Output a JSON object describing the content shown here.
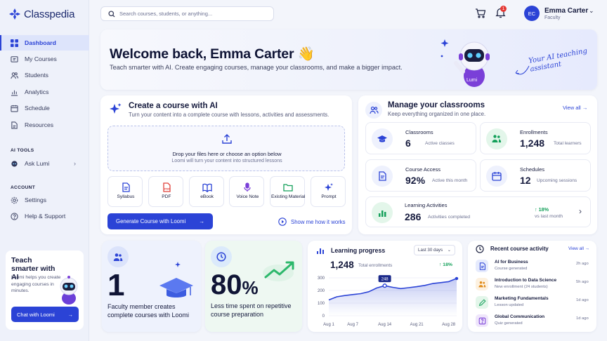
{
  "app": {
    "name": "Classpedia"
  },
  "search": {
    "placeholder": "Search courses, students, or anything..."
  },
  "header": {
    "notification_count": "1",
    "user_initials": "EC",
    "user_name": "Emma Carter",
    "user_role": "Faculty"
  },
  "sidebar": {
    "items": [
      {
        "label": "Dashboard",
        "icon": "grid-icon"
      },
      {
        "label": "My Courses",
        "icon": "courses-icon"
      },
      {
        "label": "Students",
        "icon": "students-icon"
      },
      {
        "label": "Analytics",
        "icon": "bar-chart-icon"
      },
      {
        "label": "Schedule",
        "icon": "calendar-icon"
      },
      {
        "label": "Resources",
        "icon": "document-icon"
      }
    ],
    "ai_tools_heading": "AI TOOLS",
    "ask_lumi": "Ask Lumi",
    "account_heading": "ACCOUNT",
    "settings": "Settings",
    "help": "Help & Support"
  },
  "promo": {
    "title": "Teach smarter with AI",
    "text": "Loomi helps you create engaging courses in minutes.",
    "button": "Chat with Loomi"
  },
  "hero": {
    "title": "Welcome back, Emma Carter",
    "emoji": "👋",
    "subtitle": "Teach smarter with AI. Create engaging courses, manage your classrooms, and make a bigger impact.",
    "assistant_note": "Your AI teaching assistant",
    "robot_badge": "Lumi"
  },
  "create": {
    "title": "Create a course with AI",
    "subtitle": "Turn your content into a complete course with lessons, activities and assessments.",
    "drop_title": "Drop your files here or choose an option below",
    "drop_sub": "Loomi will turn your content into structured lessons",
    "options": [
      {
        "label": "Syllabus",
        "icon": "syllabus-icon",
        "color": "#2b43d6"
      },
      {
        "label": "PDF",
        "icon": "pdf-icon",
        "color": "#e0413b"
      },
      {
        "label": "eBook",
        "icon": "ebook-icon",
        "color": "#2b43d6"
      },
      {
        "label": "Voice Note",
        "icon": "microphone-icon",
        "color": "#7a3fd8"
      },
      {
        "label": "Existing Material",
        "icon": "folder-icon",
        "color": "#14a05a"
      },
      {
        "label": "Prompt",
        "icon": "sparkle-icon",
        "color": "#2b43d6"
      }
    ],
    "generate_button": "Generate Course with Loomi",
    "show_link": "Show me how it works"
  },
  "classrooms": {
    "title": "Manage your classrooms",
    "subtitle": "Keep everything organized in one place.",
    "view_all": "View all",
    "stats": [
      {
        "label": "Classrooms",
        "value": "6",
        "caption": "Active classes",
        "icon": "graduation-cap-icon"
      },
      {
        "label": "Enrollments",
        "value": "1,248",
        "caption": "Total learners",
        "icon": "users-icon"
      },
      {
        "label": "Course Access",
        "value": "92%",
        "caption": "Active this month",
        "icon": "document-icon"
      },
      {
        "label": "Schedules",
        "value": "12",
        "caption": "Upcoming sessions",
        "icon": "calendar-icon"
      }
    ],
    "activities": {
      "label": "Learning Activities",
      "value": "286",
      "caption": "Activities completed",
      "change": "18%",
      "change_caption": "vs last month"
    }
  },
  "faculty": {
    "value": "1",
    "text": "Faculty member creates complete courses with Loomi"
  },
  "time": {
    "value": "80",
    "unit": "%",
    "text": "Less time spent on repetitive course preparation"
  },
  "progress": {
    "title": "Learning progress",
    "range": "Last 30 days",
    "value": "1,248",
    "value_caption": "Total enrollments",
    "change": "18%"
  },
  "chart_data": {
    "type": "line",
    "x": [
      "Aug 1",
      "Aug 3",
      "Aug 5",
      "Aug 7",
      "Aug 9",
      "Aug 11",
      "Aug 13",
      "Aug 14",
      "Aug 16",
      "Aug 18",
      "Aug 20",
      "Aug 21",
      "Aug 23",
      "Aug 25",
      "Aug 27",
      "Aug 28",
      "Aug 30"
    ],
    "values": [
      125,
      150,
      160,
      168,
      175,
      190,
      220,
      238,
      225,
      215,
      222,
      230,
      240,
      255,
      262,
      270,
      295
    ],
    "xticks": [
      "Aug 1",
      "Aug 7",
      "Aug 14",
      "Aug 21",
      "Aug 28"
    ],
    "yticks": [
      "300",
      "200",
      "100",
      "0"
    ],
    "ylim": [
      0,
      300
    ],
    "highlight": {
      "x": "Aug 14",
      "label": "248"
    },
    "grid": true,
    "color": "#2b43d6"
  },
  "activity": {
    "title": "Recent course activity",
    "view_all": "View all",
    "items": [
      {
        "title": "AI for Business",
        "sub": "Course generated",
        "time": "2h ago",
        "icon": "document-icon",
        "color": "#2b43d6",
        "bg": "#e6ebfd"
      },
      {
        "title": "Introduction to Data Science",
        "sub": "New enrollment (24 students)",
        "time": "5h ago",
        "icon": "users-icon",
        "color": "#e08a17",
        "bg": "#fdf1e0"
      },
      {
        "title": "Marketing Fundamentals",
        "sub": "Lesson updated",
        "time": "1d ago",
        "icon": "pencil-icon",
        "color": "#14a05a",
        "bg": "#e3f6ea"
      },
      {
        "title": "Global Communication",
        "sub": "Quiz generated",
        "time": "1d ago",
        "icon": "quiz-icon",
        "color": "#7a3fd8",
        "bg": "#efe6fb"
      }
    ]
  }
}
